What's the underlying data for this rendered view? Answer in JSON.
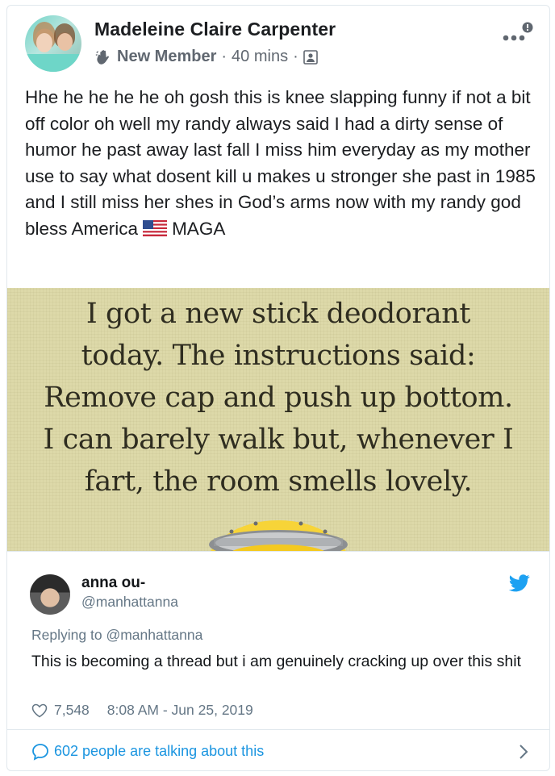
{
  "post": {
    "author": "Madeleine Claire Carpenter",
    "badge": "New Member",
    "dot1": "·",
    "time": "40 mins",
    "dot2": "·",
    "text_main": "Hhe he he he he oh gosh this is knee slapping funny if not a bit off color oh well my randy always said I had a dirty sense of humor he past away last fall I miss him everyday as my mother use to say what dosent kill u makes u stronger she past in 1985 and I still miss her shes in God’s arms now with my randy god bless America",
    "text_tail": "MAGA"
  },
  "meme": {
    "lines": [
      "I got a new stick deodorant",
      "today. The instructions said:",
      "Remove cap and push up bottom.",
      "I can barely walk but, whenever I",
      "fart, the room smells lovely."
    ]
  },
  "tweet": {
    "name": "anna ou-",
    "handle": "@manhattanna",
    "reply_prefix": "Replying to",
    "reply_to": "@manhattanna",
    "text": "This is becoming a thread but i am genuinely cracking up over this shit",
    "likes": "7,548",
    "timestamp": "8:08 AM - Jun 25, 2019"
  },
  "talking": {
    "label": "602 people are talking about this"
  },
  "colors": {
    "twitter_blue": "#1da1f2",
    "link_blue": "#1b95e0",
    "meme_bg": "#ddd9a9"
  }
}
